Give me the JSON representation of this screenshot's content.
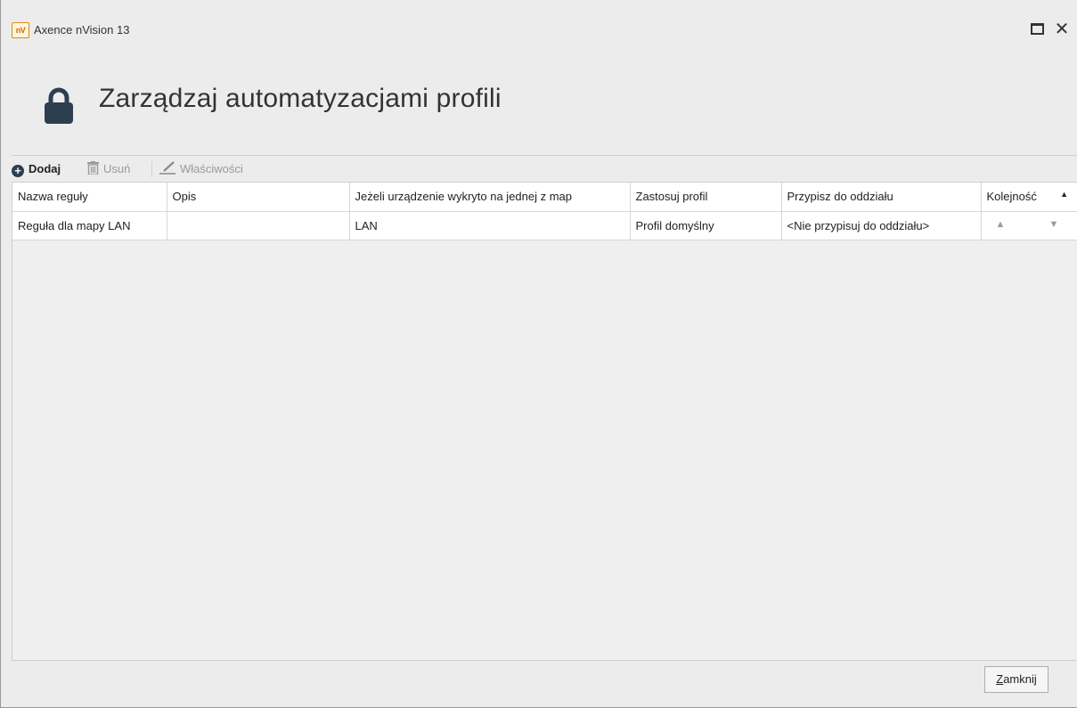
{
  "window": {
    "app_icon_text": "nV",
    "title": "Axence nVision 13"
  },
  "header": {
    "icon": "lock-icon",
    "title": "Zarządzaj automatyzacjami profili"
  },
  "toolbar": {
    "add_label": "Dodaj",
    "delete_label": "Usuń",
    "properties_label": "Właściwości"
  },
  "table": {
    "columns": [
      "Nazwa reguły",
      "Opis",
      "Jeżeli urządzenie wykryto na jednej z map",
      "Zastosuj profil",
      "Przypisz do oddziału",
      "Kolejność"
    ],
    "rows": [
      {
        "name": "Reguła dla mapy LAN",
        "description": "",
        "maps": "LAN",
        "profile": "Profil domyślny",
        "branch": "<Nie przypisuj do oddziału>"
      }
    ]
  },
  "footer": {
    "close_first_letter": "Z",
    "close_rest": "amknij"
  },
  "colors": {
    "icon_dark": "#2c3e50",
    "app_icon_orange": "#e08a10"
  }
}
